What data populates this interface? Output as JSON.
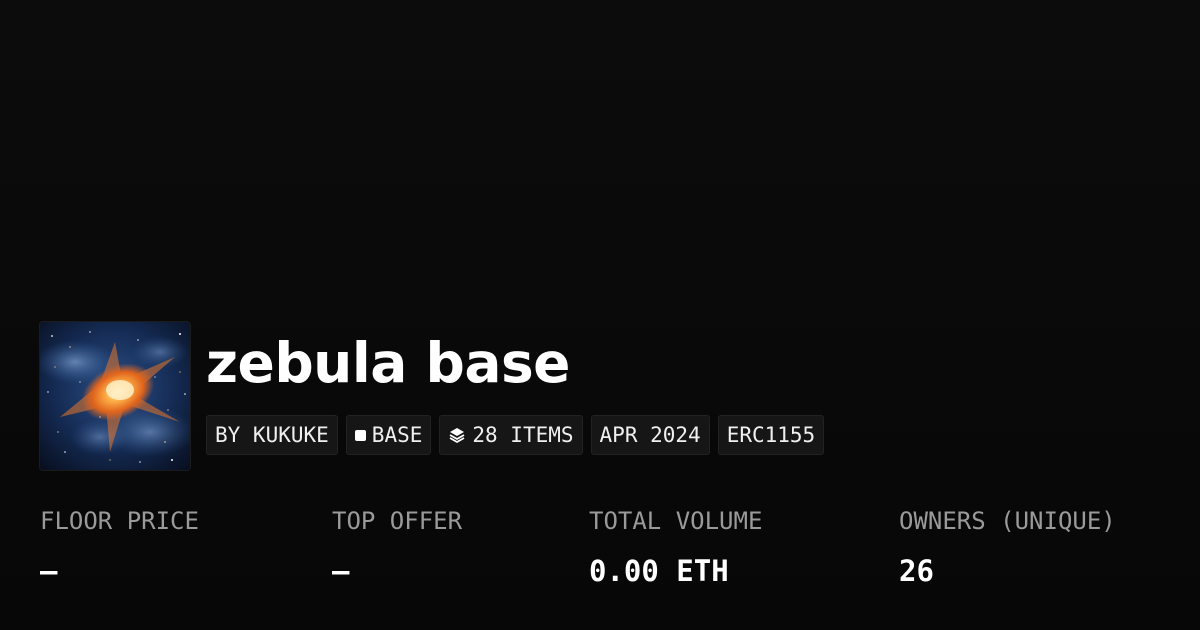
{
  "collection": {
    "name": "zebula base",
    "thumbnail_icon": "nebula-artwork",
    "badges": [
      {
        "label": "BY KUKUKE",
        "icon": null
      },
      {
        "label": "BASE",
        "icon": "chain-square-icon"
      },
      {
        "label": "28 ITEMS",
        "icon": "layers-icon"
      },
      {
        "label": "APR 2024",
        "icon": null
      },
      {
        "label": "ERC1155",
        "icon": null
      }
    ]
  },
  "stats": [
    {
      "label": "FLOOR PRICE",
      "value": "–"
    },
    {
      "label": "TOP OFFER",
      "value": "–"
    },
    {
      "label": "TOTAL VOLUME",
      "value": "0.00 ETH"
    },
    {
      "label": "OWNERS (UNIQUE)",
      "value": "26"
    }
  ],
  "colors": {
    "background": "#0a0a0a",
    "badge_bg": "#161616",
    "label_gray": "#9a9a9a",
    "text": "#ffffff",
    "nebula_orange": "#f08a2a",
    "nebula_blue": "#3a6aa8"
  }
}
